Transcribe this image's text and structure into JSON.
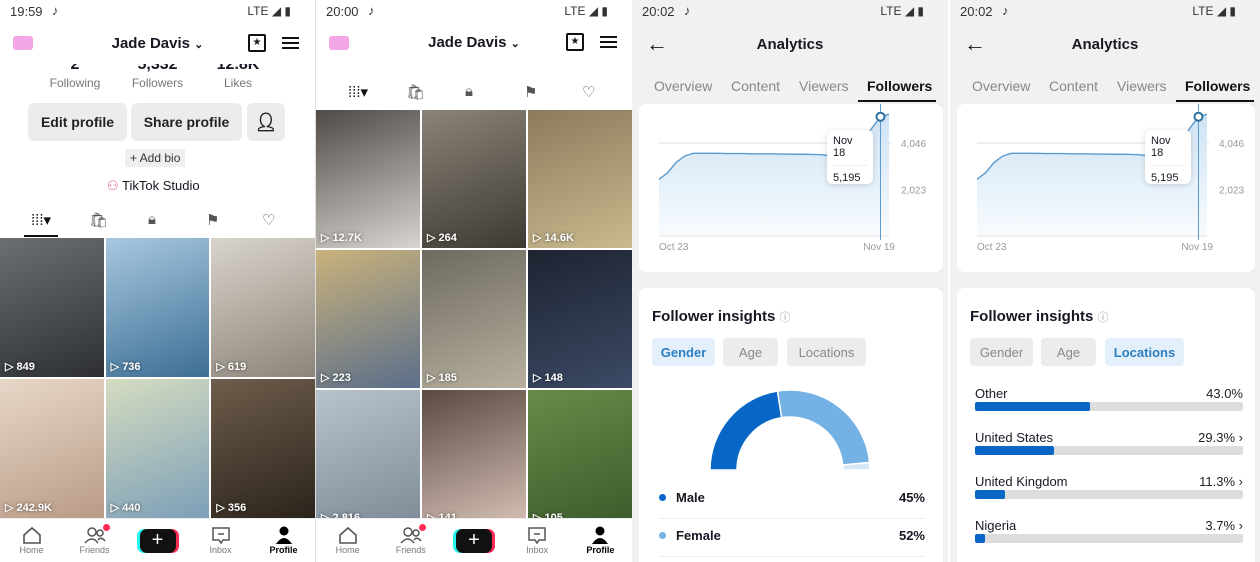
{
  "profile1": {
    "status": {
      "time": "19:59",
      "network": "LTE"
    },
    "username": "Jade Davis",
    "stats": [
      {
        "value": "2",
        "label": "Following"
      },
      {
        "value": "5,332",
        "label": "Followers"
      },
      {
        "value": "12.8K",
        "label": "Likes"
      }
    ],
    "edit_profile": "Edit profile",
    "share_profile": "Share profile",
    "add_bio": "+ Add bio",
    "studio": "TikTok Studio",
    "videos": [
      {
        "views": "849",
        "colors": [
          "#6b6f73",
          "#2d2f33"
        ]
      },
      {
        "views": "736",
        "colors": [
          "#a8c8e0",
          "#3c6e94"
        ]
      },
      {
        "views": "619",
        "colors": [
          "#d9d4cc",
          "#8d857a"
        ]
      },
      {
        "views": "242.9K",
        "colors": [
          "#e7d7c8",
          "#b99b86"
        ]
      },
      {
        "views": "440",
        "colors": [
          "#d5dcc0",
          "#7d9fb8"
        ]
      },
      {
        "views": "356",
        "colors": [
          "#6e5d4b",
          "#2b241c"
        ]
      }
    ]
  },
  "profile2": {
    "status": {
      "time": "20:00",
      "network": "LTE"
    },
    "username": "Jade Davis",
    "videos": [
      {
        "views": "12.7K",
        "colors": [
          "#4f4a46",
          "#d8d4d0"
        ]
      },
      {
        "views": "264",
        "colors": [
          "#8a8378",
          "#3e3a33"
        ]
      },
      {
        "views": "14.6K",
        "colors": [
          "#8b7b5c",
          "#c9b98e"
        ]
      },
      {
        "views": "223",
        "colors": [
          "#c9b27c",
          "#5b6e8a"
        ]
      },
      {
        "views": "185",
        "colors": [
          "#6e6a60",
          "#b7b09e"
        ]
      },
      {
        "views": "148",
        "colors": [
          "#1e2330",
          "#3c4a66"
        ]
      },
      {
        "views": "2,816",
        "colors": [
          "#b7c3cc",
          "#7c8a96"
        ]
      },
      {
        "views": "141",
        "colors": [
          "#5a4a40",
          "#d8c2b8"
        ]
      },
      {
        "views": "105",
        "colors": [
          "#6a8a4a",
          "#3b5a2a"
        ]
      }
    ]
  },
  "nav": [
    "Home",
    "Friends",
    "Inbox",
    "Profile"
  ],
  "analytics": {
    "time": "20:02",
    "network": "LTE",
    "title": "Analytics",
    "tabs": [
      "Overview",
      "Content",
      "Viewers",
      "Followers"
    ],
    "active_tab": "Followers",
    "tooltip": {
      "date": "Nov 18",
      "value": "5,195"
    },
    "insights_title": "Follower insights",
    "chips": [
      "Gender",
      "Age",
      "Locations"
    ],
    "gender": [
      {
        "label": "Male",
        "pct": "45%",
        "value": 45,
        "color": "#0866c6"
      },
      {
        "label": "Female",
        "pct": "52%",
        "value": 52,
        "color": "#74b2e6"
      }
    ],
    "gender_other_color": "#d6e8f5",
    "locations": [
      {
        "label": "Other",
        "pct": "43.0%",
        "value": 43.0,
        "chevron": ""
      },
      {
        "label": "United States",
        "pct": "29.3%",
        "value": 29.3,
        "chevron": "›"
      },
      {
        "label": "United Kingdom",
        "pct": "11.3%",
        "value": 11.3,
        "chevron": "›"
      },
      {
        "label": "Nigeria",
        "pct": "3.7%",
        "value": 3.7,
        "chevron": "›"
      }
    ]
  },
  "chart_data": {
    "type": "area",
    "x_labels": [
      "Oct 23",
      "Nov 19"
    ],
    "y_ticks": [
      "2,023",
      "4,046"
    ],
    "y_tick_values": [
      2023,
      4046
    ],
    "ylim": [
      0,
      5400
    ],
    "grid": true,
    "color": "#5a9bd0",
    "x": [
      "Oct 23",
      "Oct 24",
      "Oct 25",
      "Oct 26",
      "Oct 27",
      "Oct 28",
      "Oct 29",
      "Oct 30",
      "Oct 31",
      "Nov 1",
      "Nov 2",
      "Nov 3",
      "Nov 4",
      "Nov 5",
      "Nov 6",
      "Nov 7",
      "Nov 8",
      "Nov 9",
      "Nov 10",
      "Nov 11",
      "Nov 12",
      "Nov 13",
      "Nov 14",
      "Nov 15",
      "Nov 16",
      "Nov 17",
      "Nov 18",
      "Nov 19"
    ],
    "values": [
      2470,
      2750,
      3200,
      3480,
      3600,
      3600,
      3600,
      3600,
      3590,
      3590,
      3590,
      3580,
      3580,
      3580,
      3570,
      3570,
      3560,
      3560,
      3550,
      3540,
      3500,
      3500,
      3500,
      3800,
      4200,
      4700,
      5195,
      5300
    ]
  }
}
